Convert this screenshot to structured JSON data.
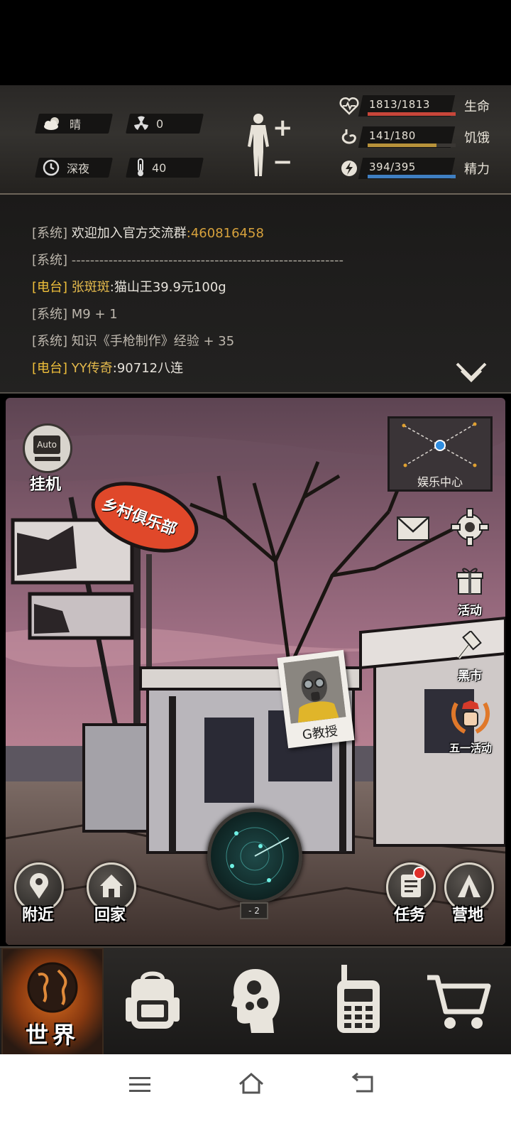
{
  "status": {
    "weather": "晴",
    "radiation": "0",
    "time_of_day": "深夜",
    "temperature": "40",
    "body_plus": "+",
    "body_minus": "−",
    "life": {
      "label": "生命",
      "text": "1813/1813",
      "ratio": 1.0,
      "color": "#c8463a"
    },
    "hunger": {
      "label": "饥饿",
      "text": "141/180",
      "ratio": 0.78,
      "color": "#b8923a"
    },
    "energy": {
      "label": "精力",
      "text": "394/395",
      "ratio": 0.997,
      "color": "#3f7fc2"
    }
  },
  "log": {
    "lines": [
      {
        "tag": "[系统]",
        "kind": "sys",
        "text": "欢迎加入官方交流群",
        "extra": ":460816458"
      },
      {
        "tag": "[系统]",
        "kind": "sys",
        "text": "-----------------------------------------------------------",
        "extra": ""
      },
      {
        "tag": "[电台]",
        "kind": "radio",
        "name": "张斑斑",
        "text": ":猫山王39.9元100g"
      },
      {
        "tag": "[系统]",
        "kind": "sys",
        "text": "M9 + 1",
        "extra": ""
      },
      {
        "tag": "[系统]",
        "kind": "sys",
        "text": "知识《手枪制作》经验 + 35",
        "extra": ""
      },
      {
        "tag": "[电台]",
        "kind": "radio",
        "name": "YY传奇",
        "text": ":90712八连"
      }
    ]
  },
  "scene": {
    "club_sign": "乡村俱乐部",
    "auto_badge": "Auto",
    "auto_label": "挂机",
    "map_label": "娱乐中心",
    "npc_name": "G教授",
    "activity_label": "活动",
    "market_label": "黑市",
    "mayday_label": "五一活动",
    "nearby_label": "附近",
    "home_label": "回家",
    "task_label": "任务",
    "camp_label": "营地",
    "radar_level": "- 2"
  },
  "tabs": [
    {
      "id": "world",
      "label": "世界",
      "icon": "globe-icon",
      "active": true
    },
    {
      "id": "bag",
      "label": "",
      "icon": "backpack-icon",
      "active": false
    },
    {
      "id": "skills",
      "label": "",
      "icon": "head-gears-icon",
      "active": false
    },
    {
      "id": "radio",
      "label": "",
      "icon": "walkie-talkie-icon",
      "active": false
    },
    {
      "id": "shop",
      "label": "",
      "icon": "cart-icon",
      "active": false
    }
  ]
}
